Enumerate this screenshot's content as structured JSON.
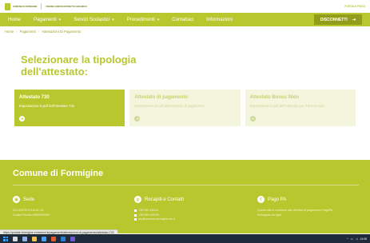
{
  "header": {
    "logo_left": "COMUNE DI FORMIGINE",
    "logo_right": "UNIONE COMUNI DISTRETTO CERAMICO",
    "top_link": "PORTALE FISCO"
  },
  "nav": {
    "items": [
      {
        "label": "Home",
        "has_menu": false
      },
      {
        "label": "Pagamenti",
        "has_menu": true
      },
      {
        "label": "Servizi Scolastici",
        "has_menu": true
      },
      {
        "label": "Procedimenti",
        "has_menu": true
      },
      {
        "label": "Contattaci",
        "has_menu": false
      },
      {
        "label": "Informazioni",
        "has_menu": false
      }
    ],
    "button_label": "DISCONNETTI"
  },
  "breadcrumb": [
    "Home",
    "Pagamenti",
    "Attestazioni Di Pagamento"
  ],
  "title": "Selezionare la tipologia dell'attestato:",
  "cards": [
    {
      "title": "Attestato 730",
      "desc": "Esportazione in pdf dell'Attestato 730",
      "active": true
    },
    {
      "title": "Attestato di pagamento",
      "desc": "Esportazione in pdf dell'Attestato di pagamento",
      "active": false
    },
    {
      "title": "Attestato Bonus Nido",
      "desc": "Esportazione in pdf dell'Attestato per il Bonus Nido",
      "active": false
    }
  ],
  "footer": {
    "title": "Comune di Formigine",
    "columns": [
      {
        "heading": "Sede",
        "icon": "building-icon",
        "lines": [
          "VIA UNITÀ D'ITALIA, 26",
          "Codice Fiscale 00603990367"
        ]
      },
      {
        "heading": "Recapiti e Contatti",
        "icon": "globe-icon",
        "lines": [
          "+39 059 416111",
          "+39 059 416330",
          "urp@comune.formigine.mo.it"
        ]
      },
      {
        "heading": "Pago PA",
        "icon": "pagopa-icon",
        "lines": [
          "Questo sito è conforme alle direttive di pagamento PagoPA",
          "Sviluppato da Agid"
        ]
      }
    ]
  },
  "status_url": "https://portale-formigine.entranext.it/pagamenti/attestazioni-di-pagamento/attestato-730",
  "taskbar": {
    "time": "14:08"
  },
  "colors": {
    "accent": "#b9c72f",
    "accent_dark": "#929d1c",
    "card_inactive": "#f3f5dc"
  }
}
